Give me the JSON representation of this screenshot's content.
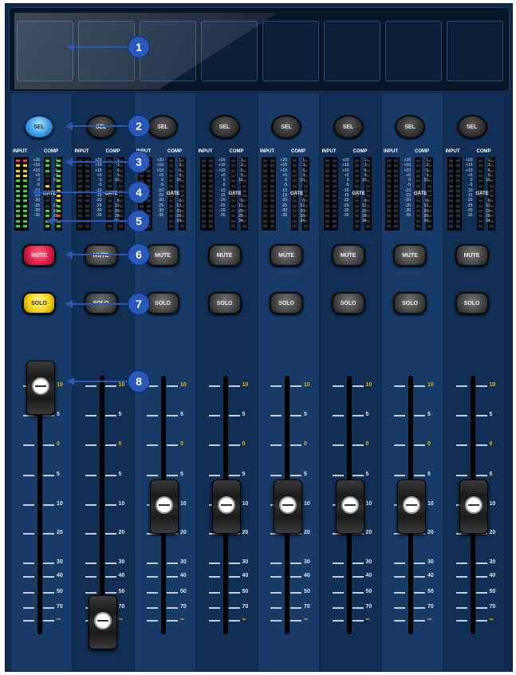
{
  "channels": [
    {
      "sel": "SEL",
      "mute": "MUTE",
      "solo": "SOLO",
      "sel_active": true,
      "mute_active": true,
      "solo_active": true,
      "fader_label": "10"
    },
    {
      "sel": "SEL",
      "mute": "MUTE",
      "solo": "SOLO",
      "sel_active": false,
      "mute_active": false,
      "solo_active": false,
      "fader_label": "∞"
    },
    {
      "sel": "SEL",
      "mute": "MUTE",
      "solo": "SOLO",
      "sel_active": false,
      "mute_active": false,
      "solo_active": false,
      "fader_label": "10"
    },
    {
      "sel": "SEL",
      "mute": "MUTE",
      "solo": "SOLO",
      "sel_active": false,
      "mute_active": false,
      "solo_active": false,
      "fader_label": "10"
    },
    {
      "sel": "SEL",
      "mute": "MUTE",
      "solo": "SOLO",
      "sel_active": false,
      "mute_active": false,
      "solo_active": false,
      "fader_label": "10"
    },
    {
      "sel": "SEL",
      "mute": "MUTE",
      "solo": "SOLO",
      "sel_active": false,
      "mute_active": false,
      "solo_active": false,
      "fader_label": "10"
    },
    {
      "sel": "SEL",
      "mute": "MUTE",
      "solo": "SOLO",
      "sel_active": false,
      "mute_active": false,
      "solo_active": false,
      "fader_label": "10"
    },
    {
      "sel": "SEL",
      "mute": "MUTE",
      "solo": "SOLO",
      "sel_active": false,
      "mute_active": false,
      "solo_active": false,
      "fader_label": "10"
    }
  ],
  "meter": {
    "input_label": "INPUT",
    "comp_label": "COMP",
    "gate_label": "GATE",
    "input_scale": [
      "+20",
      "+16",
      "+10",
      "+5",
      "0",
      "-5",
      "-10",
      "-15",
      "-20",
      "-25",
      "-30",
      "-35"
    ],
    "comp_scale": [
      "1",
      "3",
      "6",
      "9",
      "15"
    ],
    "gate_scale": [
      "6",
      "12",
      "20",
      "28",
      "34"
    ]
  },
  "fader_scale": [
    "10",
    "5",
    "0",
    "5",
    "10",
    "20",
    "30",
    "40",
    "50",
    "70",
    "∞"
  ],
  "fader_positions_db": [
    "10",
    "∞",
    "10",
    "10",
    "10",
    "10",
    "10",
    "10"
  ],
  "callouts": [
    "1",
    "2",
    "3",
    "4",
    "5",
    "6",
    "7",
    "8"
  ],
  "colors": {
    "sel_active": "#3a9be8",
    "mute_active": "#e0204a",
    "solo_active": "#f2d21a",
    "callout": "#2a58b8",
    "scale_highlight": "#f0b400"
  }
}
